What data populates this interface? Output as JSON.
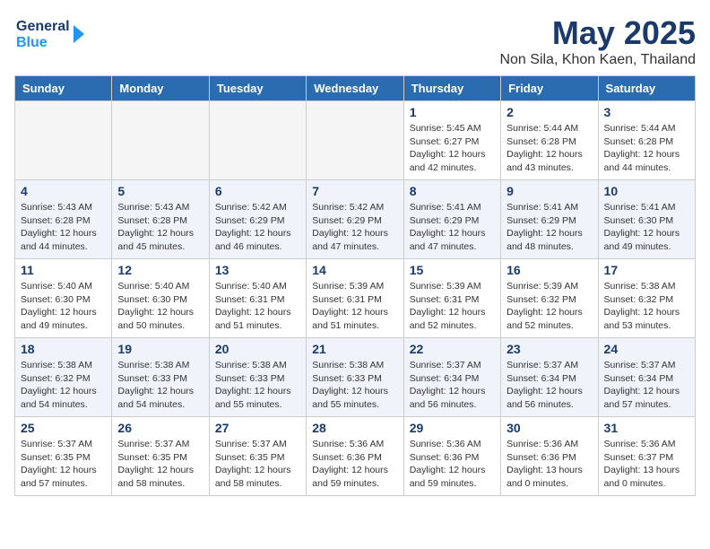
{
  "header": {
    "logo_line1": "General",
    "logo_line2": "Blue",
    "month": "May 2025",
    "location": "Non Sila, Khon Kaen, Thailand"
  },
  "weekdays": [
    "Sunday",
    "Monday",
    "Tuesday",
    "Wednesday",
    "Thursday",
    "Friday",
    "Saturday"
  ],
  "weeks": [
    [
      {
        "day": "",
        "info": ""
      },
      {
        "day": "",
        "info": ""
      },
      {
        "day": "",
        "info": ""
      },
      {
        "day": "",
        "info": ""
      },
      {
        "day": "1",
        "info": "Sunrise: 5:45 AM\nSunset: 6:27 PM\nDaylight: 12 hours\nand 42 minutes."
      },
      {
        "day": "2",
        "info": "Sunrise: 5:44 AM\nSunset: 6:28 PM\nDaylight: 12 hours\nand 43 minutes."
      },
      {
        "day": "3",
        "info": "Sunrise: 5:44 AM\nSunset: 6:28 PM\nDaylight: 12 hours\nand 44 minutes."
      }
    ],
    [
      {
        "day": "4",
        "info": "Sunrise: 5:43 AM\nSunset: 6:28 PM\nDaylight: 12 hours\nand 44 minutes."
      },
      {
        "day": "5",
        "info": "Sunrise: 5:43 AM\nSunset: 6:28 PM\nDaylight: 12 hours\nand 45 minutes."
      },
      {
        "day": "6",
        "info": "Sunrise: 5:42 AM\nSunset: 6:29 PM\nDaylight: 12 hours\nand 46 minutes."
      },
      {
        "day": "7",
        "info": "Sunrise: 5:42 AM\nSunset: 6:29 PM\nDaylight: 12 hours\nand 47 minutes."
      },
      {
        "day": "8",
        "info": "Sunrise: 5:41 AM\nSunset: 6:29 PM\nDaylight: 12 hours\nand 47 minutes."
      },
      {
        "day": "9",
        "info": "Sunrise: 5:41 AM\nSunset: 6:29 PM\nDaylight: 12 hours\nand 48 minutes."
      },
      {
        "day": "10",
        "info": "Sunrise: 5:41 AM\nSunset: 6:30 PM\nDaylight: 12 hours\nand 49 minutes."
      }
    ],
    [
      {
        "day": "11",
        "info": "Sunrise: 5:40 AM\nSunset: 6:30 PM\nDaylight: 12 hours\nand 49 minutes."
      },
      {
        "day": "12",
        "info": "Sunrise: 5:40 AM\nSunset: 6:30 PM\nDaylight: 12 hours\nand 50 minutes."
      },
      {
        "day": "13",
        "info": "Sunrise: 5:40 AM\nSunset: 6:31 PM\nDaylight: 12 hours\nand 51 minutes."
      },
      {
        "day": "14",
        "info": "Sunrise: 5:39 AM\nSunset: 6:31 PM\nDaylight: 12 hours\nand 51 minutes."
      },
      {
        "day": "15",
        "info": "Sunrise: 5:39 AM\nSunset: 6:31 PM\nDaylight: 12 hours\nand 52 minutes."
      },
      {
        "day": "16",
        "info": "Sunrise: 5:39 AM\nSunset: 6:32 PM\nDaylight: 12 hours\nand 52 minutes."
      },
      {
        "day": "17",
        "info": "Sunrise: 5:38 AM\nSunset: 6:32 PM\nDaylight: 12 hours\nand 53 minutes."
      }
    ],
    [
      {
        "day": "18",
        "info": "Sunrise: 5:38 AM\nSunset: 6:32 PM\nDaylight: 12 hours\nand 54 minutes."
      },
      {
        "day": "19",
        "info": "Sunrise: 5:38 AM\nSunset: 6:33 PM\nDaylight: 12 hours\nand 54 minutes."
      },
      {
        "day": "20",
        "info": "Sunrise: 5:38 AM\nSunset: 6:33 PM\nDaylight: 12 hours\nand 55 minutes."
      },
      {
        "day": "21",
        "info": "Sunrise: 5:38 AM\nSunset: 6:33 PM\nDaylight: 12 hours\nand 55 minutes."
      },
      {
        "day": "22",
        "info": "Sunrise: 5:37 AM\nSunset: 6:34 PM\nDaylight: 12 hours\nand 56 minutes."
      },
      {
        "day": "23",
        "info": "Sunrise: 5:37 AM\nSunset: 6:34 PM\nDaylight: 12 hours\nand 56 minutes."
      },
      {
        "day": "24",
        "info": "Sunrise: 5:37 AM\nSunset: 6:34 PM\nDaylight: 12 hours\nand 57 minutes."
      }
    ],
    [
      {
        "day": "25",
        "info": "Sunrise: 5:37 AM\nSunset: 6:35 PM\nDaylight: 12 hours\nand 57 minutes."
      },
      {
        "day": "26",
        "info": "Sunrise: 5:37 AM\nSunset: 6:35 PM\nDaylight: 12 hours\nand 58 minutes."
      },
      {
        "day": "27",
        "info": "Sunrise: 5:37 AM\nSunset: 6:35 PM\nDaylight: 12 hours\nand 58 minutes."
      },
      {
        "day": "28",
        "info": "Sunrise: 5:36 AM\nSunset: 6:36 PM\nDaylight: 12 hours\nand 59 minutes."
      },
      {
        "day": "29",
        "info": "Sunrise: 5:36 AM\nSunset: 6:36 PM\nDaylight: 12 hours\nand 59 minutes."
      },
      {
        "day": "30",
        "info": "Sunrise: 5:36 AM\nSunset: 6:36 PM\nDaylight: 13 hours\nand 0 minutes."
      },
      {
        "day": "31",
        "info": "Sunrise: 5:36 AM\nSunset: 6:37 PM\nDaylight: 13 hours\nand 0 minutes."
      }
    ]
  ]
}
